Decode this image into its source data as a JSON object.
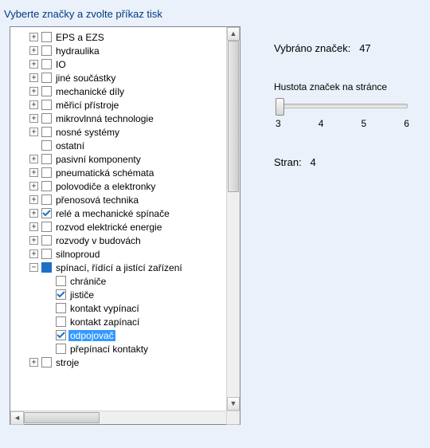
{
  "heading": "Vyberte značky a zvolte příkaz tisk",
  "tree": [
    {
      "level": 1,
      "expander": "plus",
      "checked": false,
      "label": "EPS a EZS"
    },
    {
      "level": 1,
      "expander": "plus",
      "checked": false,
      "label": "hydraulika"
    },
    {
      "level": 1,
      "expander": "plus",
      "checked": false,
      "label": "IO"
    },
    {
      "level": 1,
      "expander": "plus",
      "checked": false,
      "label": "jiné součástky"
    },
    {
      "level": 1,
      "expander": "plus",
      "checked": false,
      "label": "mechanické díly"
    },
    {
      "level": 1,
      "expander": "plus",
      "checked": false,
      "label": "měřicí přístroje"
    },
    {
      "level": 1,
      "expander": "plus",
      "checked": false,
      "label": "mikrovlnná technologie"
    },
    {
      "level": 1,
      "expander": "plus",
      "checked": false,
      "label": "nosné systémy"
    },
    {
      "level": 1,
      "expander": "none",
      "checked": false,
      "label": "ostatní"
    },
    {
      "level": 1,
      "expander": "plus",
      "checked": false,
      "label": "pasivní komponenty"
    },
    {
      "level": 1,
      "expander": "plus",
      "checked": false,
      "label": "pneumatická schémata"
    },
    {
      "level": 1,
      "expander": "plus",
      "checked": false,
      "label": "polovodiče a elektronky"
    },
    {
      "level": 1,
      "expander": "plus",
      "checked": false,
      "label": "přenosová technika"
    },
    {
      "level": 1,
      "expander": "plus",
      "checked": true,
      "label": "relé a mechanické spínače"
    },
    {
      "level": 1,
      "expander": "plus",
      "checked": false,
      "label": "rozvod elektrické energie"
    },
    {
      "level": 1,
      "expander": "plus",
      "checked": false,
      "label": "rozvody v budovách"
    },
    {
      "level": 1,
      "expander": "plus",
      "checked": false,
      "label": "silnoproud"
    },
    {
      "level": 1,
      "expander": "minus",
      "checked": "filled",
      "label": "spínací, řídící a jistící zařízení"
    },
    {
      "level": 2,
      "expander": "none",
      "checked": false,
      "label": "chrániče"
    },
    {
      "level": 2,
      "expander": "none",
      "checked": true,
      "label": "jističe"
    },
    {
      "level": 2,
      "expander": "none",
      "checked": false,
      "label": "kontakt vypínací"
    },
    {
      "level": 2,
      "expander": "none",
      "checked": false,
      "label": "kontakt zapínací"
    },
    {
      "level": 2,
      "expander": "none",
      "checked": true,
      "label": "odpojovač",
      "selected": true
    },
    {
      "level": 2,
      "expander": "none",
      "checked": false,
      "label": "přepínací kontakty"
    },
    {
      "level": 1,
      "expander": "plus",
      "checked": false,
      "label": "stroje"
    }
  ],
  "side": {
    "selected_label": "Vybráno značek:",
    "selected_value": "47",
    "density_label": "Hustota značek na stránce",
    "ticks": [
      "3",
      "4",
      "5",
      "6"
    ],
    "pages_label": "Stran:",
    "pages_value": "4"
  }
}
